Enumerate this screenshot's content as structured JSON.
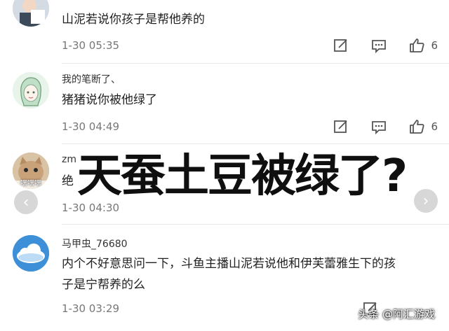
{
  "comments": [
    {
      "username": "",
      "text": "山泥若说你孩子是帮他养的",
      "time": "1-30 05:35",
      "likes": "6",
      "avatar_icon": "person-photo-avatar"
    },
    {
      "username": "我的笔断了、",
      "text": "猪猪说你被他绿了",
      "time": "1-30 04:49",
      "likes": "6",
      "avatar_icon": "anime-girl-avatar"
    },
    {
      "username": "zm",
      "text": "绝",
      "time": "1-30 04:30",
      "likes": "",
      "avatar_icon": "cat-avatar",
      "avatar_caption": "嘿嘿嘿"
    },
    {
      "username": "马甲虫_76680",
      "text_lines": [
        "内个不好意思问一下，斗鱼主播山泥若说他和伊芙蕾雅生下的孩",
        "子是宁帮养的么"
      ],
      "time": "1-30 03:29",
      "likes": "",
      "avatar_icon": "cloud-avatar"
    }
  ],
  "overlay": {
    "headline": "天蚕土豆被绿了?"
  },
  "watermark": "头条 @阿汇游戏",
  "icons": {
    "edit": "edit-icon",
    "message": "message-icon",
    "like": "thumbs-up-icon",
    "prev": "chevron-left-icon",
    "next": "chevron-right-icon"
  },
  "colors": {
    "avatar_green": "#e8f3ea",
    "avatar_blue": "#3d8fd8",
    "cat_tan": "#c9a27a"
  }
}
